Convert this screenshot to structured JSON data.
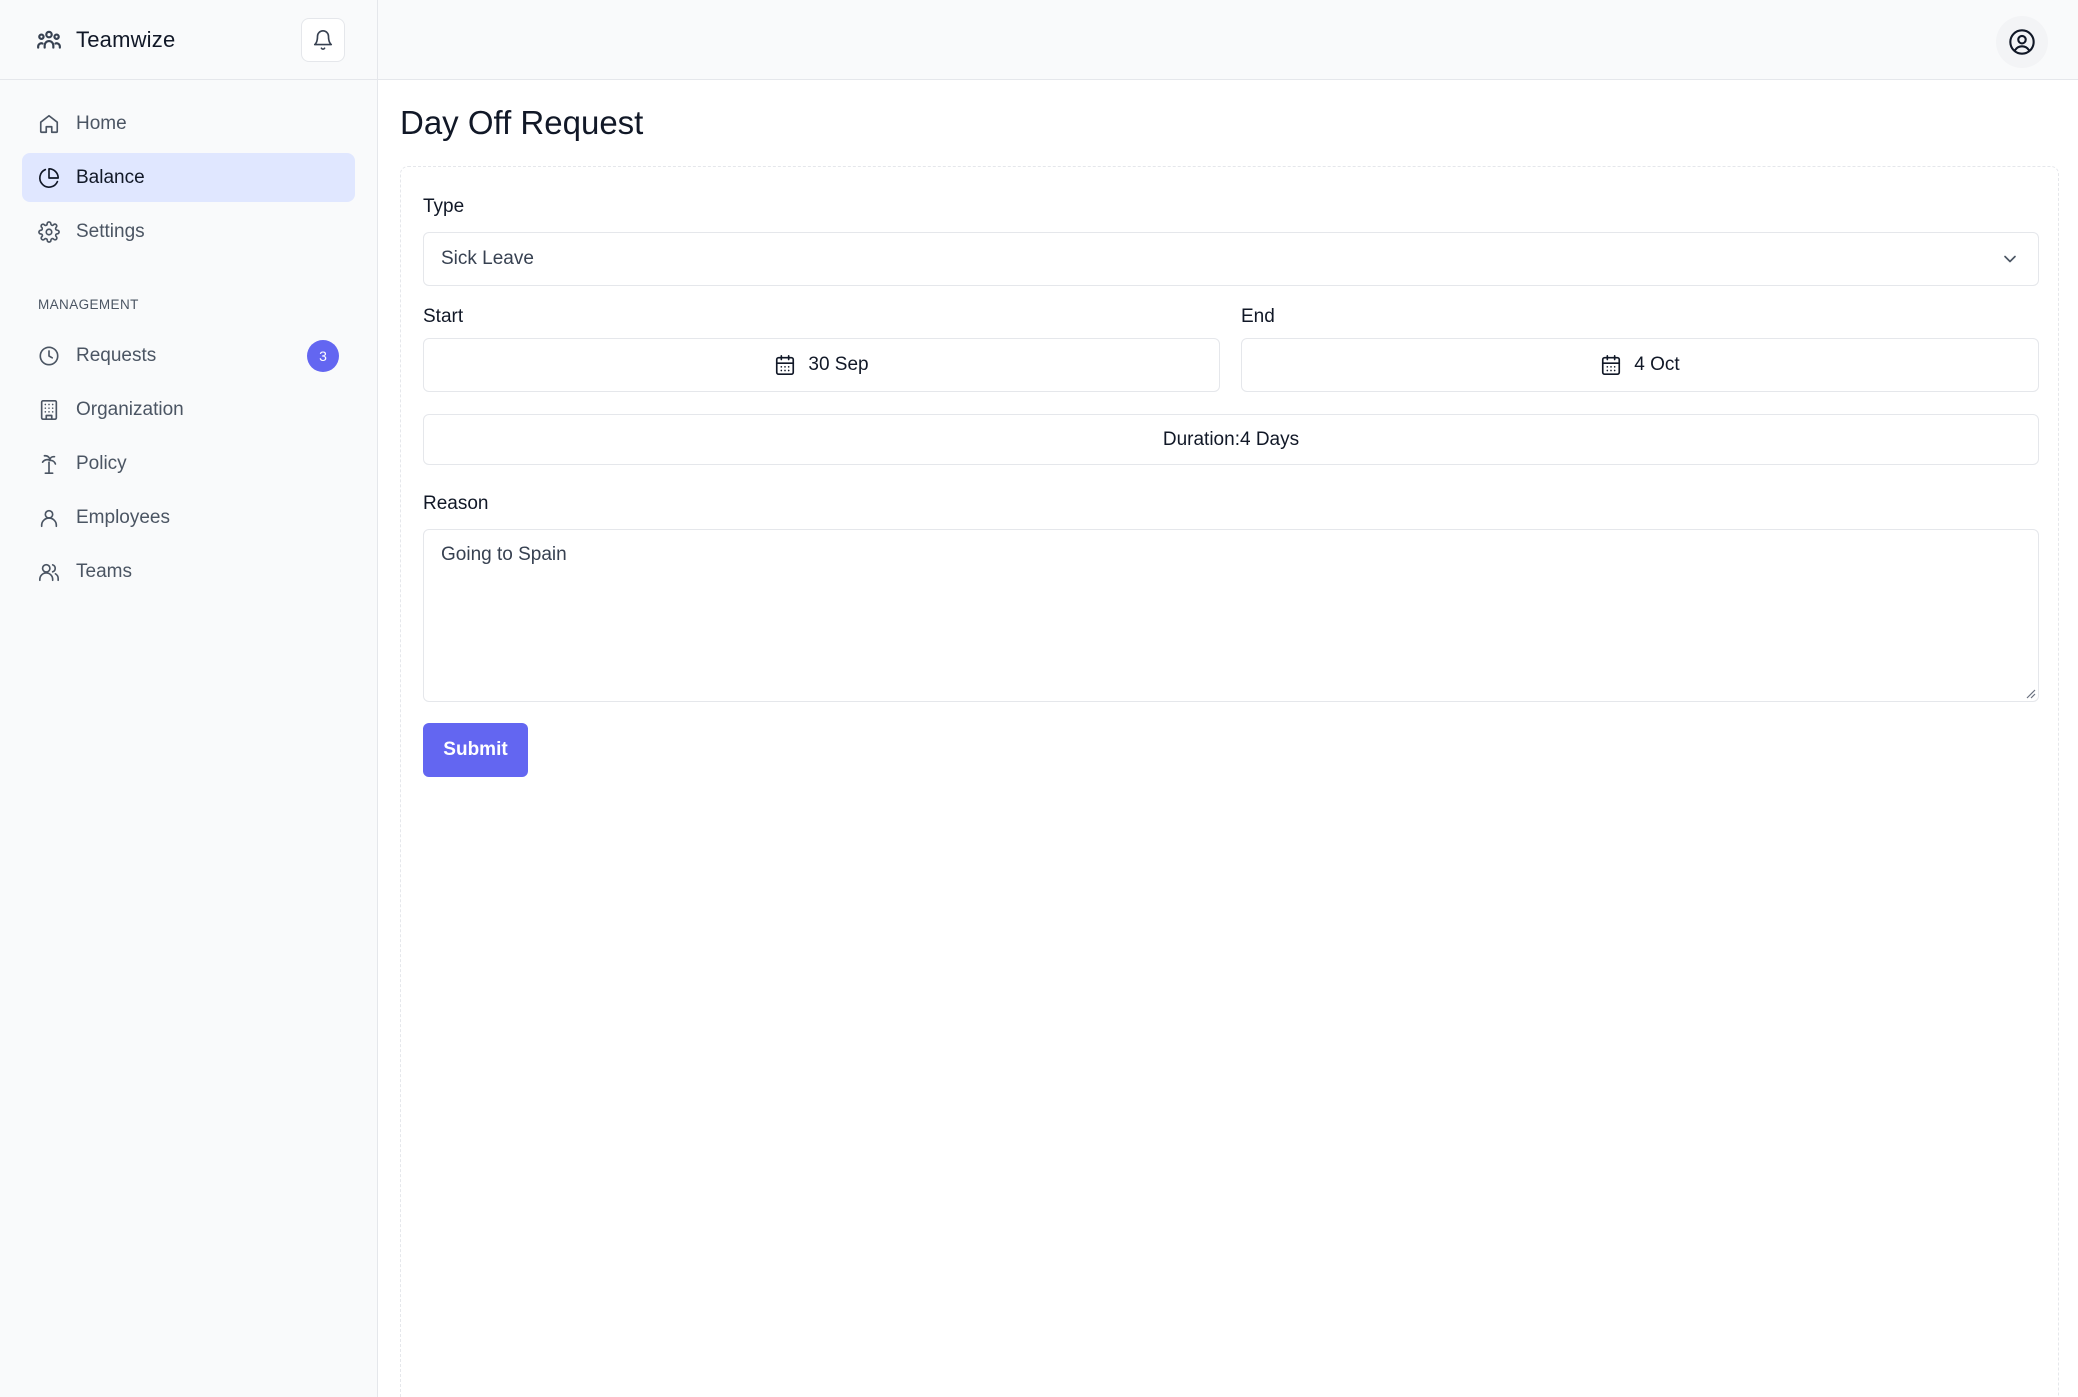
{
  "app": {
    "name": "Teamwize",
    "logo_icon": "users-icon",
    "notification_icon": "bell-icon",
    "user_icon": "user-circle-icon"
  },
  "sidebar": {
    "items": [
      {
        "label": "Home",
        "icon": "home-icon"
      },
      {
        "label": "Balance",
        "icon": "pie-chart-icon",
        "active": true
      },
      {
        "label": "Settings",
        "icon": "gear-icon"
      }
    ],
    "section_title": "MANAGEMENT",
    "management_items": [
      {
        "label": "Requests",
        "icon": "clock-icon",
        "badge": "3"
      },
      {
        "label": "Organization",
        "icon": "building-icon"
      },
      {
        "label": "Policy",
        "icon": "palm-tree-icon"
      },
      {
        "label": "Employees",
        "icon": "user-icon"
      },
      {
        "label": "Teams",
        "icon": "users-icon"
      }
    ]
  },
  "page": {
    "title": "Day Off Request"
  },
  "form": {
    "type_label": "Type",
    "type_value": "Sick Leave",
    "start_label": "Start",
    "start_value": "30 Sep",
    "end_label": "End",
    "end_value": "4 Oct",
    "duration_text": "Duration:4 Days",
    "reason_label": "Reason",
    "reason_value": "Going to Spain",
    "submit_label": "Submit"
  },
  "colors": {
    "accent": "#6366f1",
    "active_nav_bg": "#e0e7ff",
    "sidebar_bg": "#f9fafb",
    "border": "#e5e7eb"
  }
}
